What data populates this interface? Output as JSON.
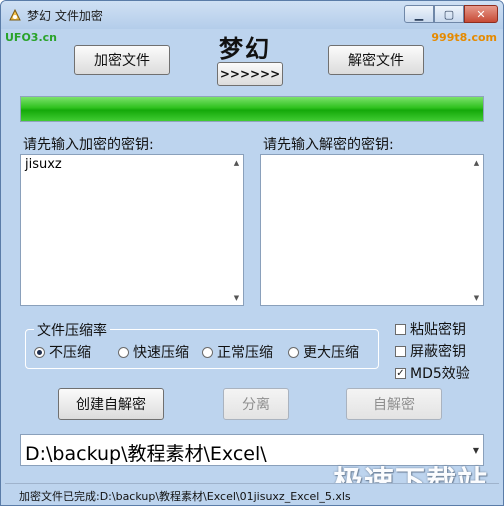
{
  "window": {
    "title": "梦幻 文件加密",
    "minimize_glyph": "▁",
    "maximize_glyph": "▢",
    "close_glyph": "✕"
  },
  "brand": {
    "left": "UFO3.cn",
    "right": "999t8.com",
    "heading": "梦幻"
  },
  "buttons": {
    "encrypt_file": "加密文件",
    "arrows": ">>>>>>",
    "decrypt_file": "解密文件",
    "create_self_decrypt": "创建自解密",
    "split": "分离",
    "self_decrypt": "自解密"
  },
  "progress": {
    "percent": 100
  },
  "encrypt_key": {
    "label": "请先输入加密的密钥:",
    "value": "jisuxz"
  },
  "decrypt_key": {
    "label": "请先输入解密的密钥:",
    "value": ""
  },
  "compression": {
    "legend": "文件压缩率",
    "options": [
      "不压缩",
      "快速压缩",
      "正常压缩",
      "更大压缩"
    ],
    "selected": "不压缩"
  },
  "options": {
    "paste_key": {
      "label": "粘贴密钥",
      "checked": false
    },
    "hide_key": {
      "label": "屏蔽密钥",
      "checked": false
    },
    "md5_verify": {
      "label": "MD5效验",
      "checked": true
    }
  },
  "path": {
    "value": "D:\\backup\\教程素材\\Excel\\"
  },
  "status": {
    "text": "加密文件已完成:D:\\backup\\教程素材\\Excel\\01jisuxz_Excel_5.xls"
  },
  "watermark": "极速下载站",
  "colors": {
    "window_bg": "#bdd4ee",
    "progress_green": "#2fc11e",
    "brand_left": "#2aa32a",
    "brand_right": "#e58a00"
  }
}
